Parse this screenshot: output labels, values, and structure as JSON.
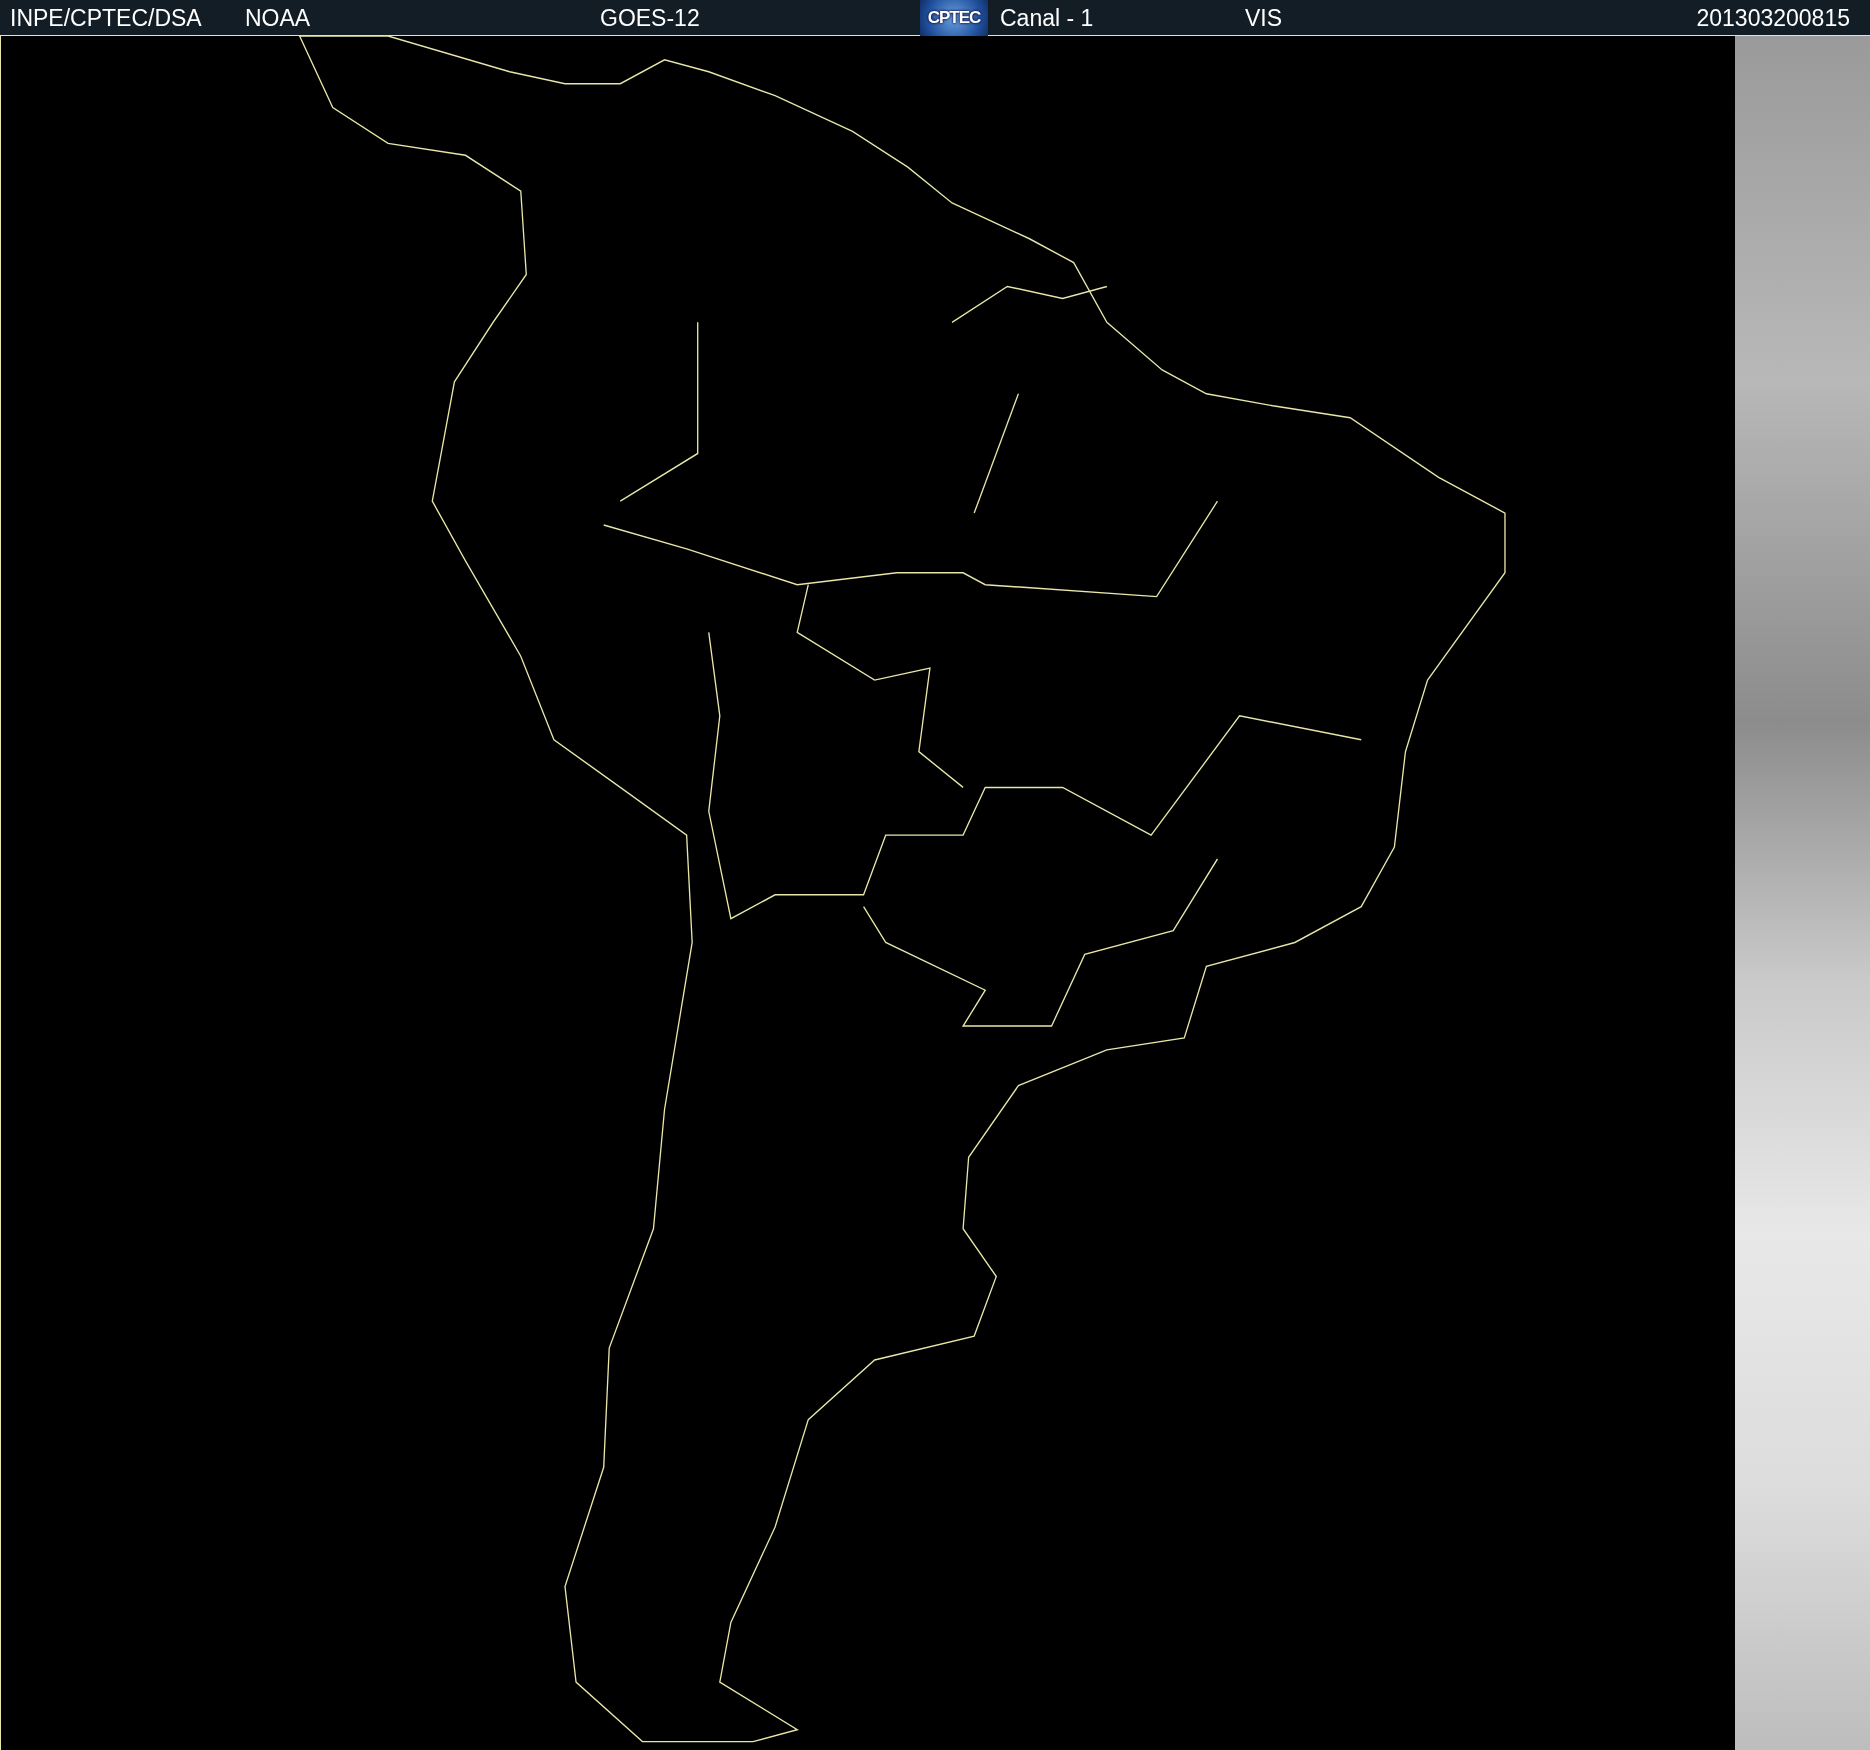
{
  "header": {
    "items": [
      {
        "kind": "text",
        "text": "INPE/CPTEC/DSA"
      },
      {
        "kind": "text",
        "text": "NOAA"
      },
      {
        "kind": "text",
        "text": "GOES-12"
      },
      {
        "kind": "logo",
        "text": "CPTEC"
      },
      {
        "kind": "text",
        "text": "Canal - 1"
      },
      {
        "kind": "text",
        "text": "VIS"
      },
      {
        "kind": "text",
        "text": "201303200815"
      }
    ]
  }
}
